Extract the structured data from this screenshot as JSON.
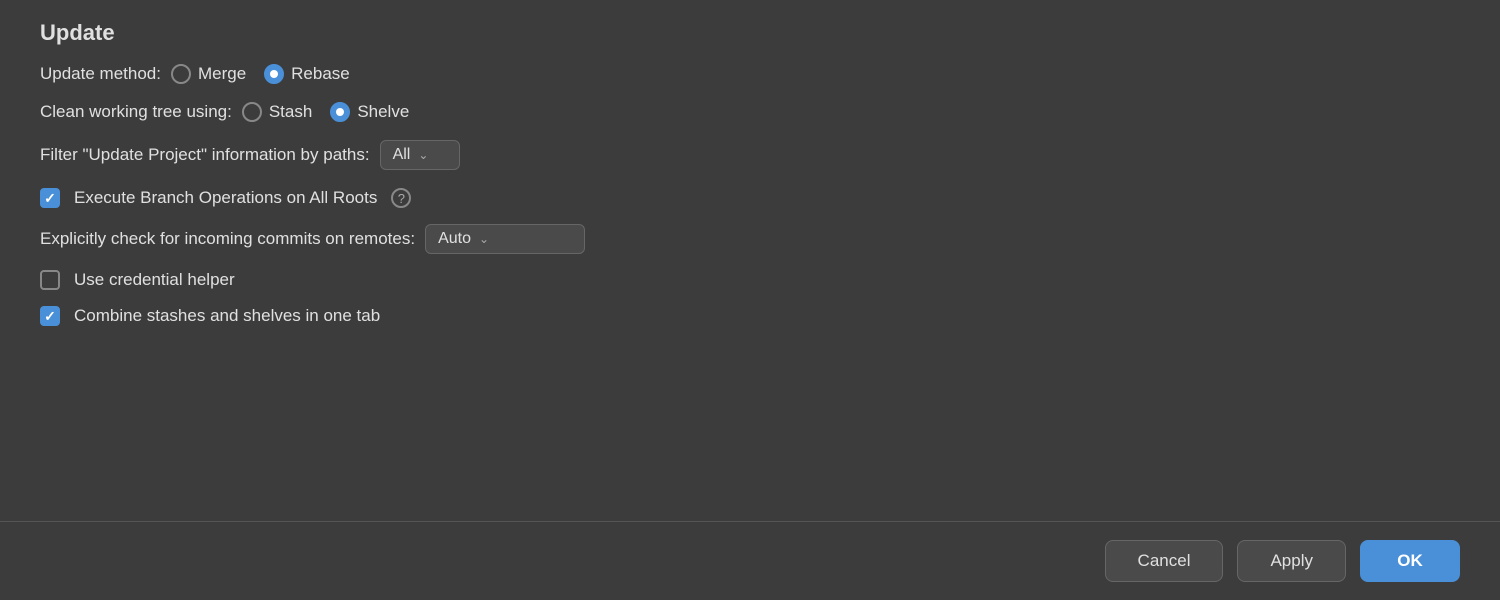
{
  "section": {
    "title": "Update"
  },
  "update_method": {
    "label": "Update method:",
    "options": [
      {
        "id": "merge",
        "label": "Merge",
        "selected": false
      },
      {
        "id": "rebase",
        "label": "Rebase",
        "selected": true
      }
    ]
  },
  "clean_working_tree": {
    "label": "Clean working tree using:",
    "options": [
      {
        "id": "stash",
        "label": "Stash",
        "selected": false
      },
      {
        "id": "shelve",
        "label": "Shelve",
        "selected": true
      }
    ]
  },
  "filter_paths": {
    "label": "Filter \"Update Project\" information by paths:",
    "dropdown_value": "All"
  },
  "execute_branch": {
    "label": "Execute Branch Operations on All Roots",
    "checked": true
  },
  "incoming_commits": {
    "label": "Explicitly check for incoming commits on remotes:",
    "dropdown_value": "Auto"
  },
  "use_credential_helper": {
    "label": "Use credential helper",
    "checked": false
  },
  "combine_stashes": {
    "label": "Combine stashes and shelves in one tab",
    "checked": true
  },
  "footer": {
    "cancel_label": "Cancel",
    "apply_label": "Apply",
    "ok_label": "OK"
  }
}
